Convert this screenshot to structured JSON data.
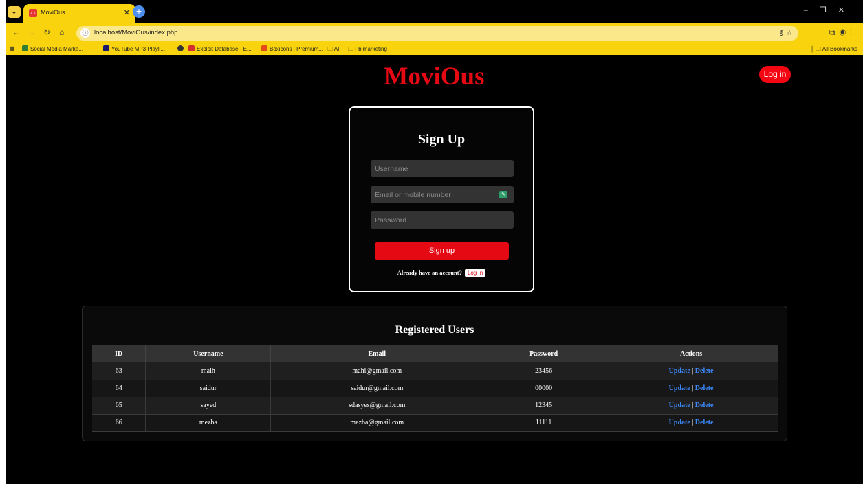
{
  "browser": {
    "tab_title": "MoviOus",
    "url": "localhost/MoviOus/index.php",
    "bookmarks": [
      {
        "label": "Social Media Marke...",
        "color": "#2e7d32"
      },
      {
        "label": "YouTube MP3 Playli...",
        "color": "#1a1a6e"
      },
      {
        "label": "",
        "color": "#333333"
      },
      {
        "label": "Exploit Database - E...",
        "color": "#d32f2f"
      },
      {
        "label": "Boxicons : Premium...",
        "color": "#e64a19"
      },
      {
        "label": "AI",
        "color": "none"
      },
      {
        "label": "Fb marketing",
        "color": "none"
      }
    ],
    "all_bookmarks": "All Bookmarks",
    "accent_color": "#f8d30e"
  },
  "header": {
    "brand": "MoviOus",
    "login_button": "Log in",
    "brand_color": "#e50914"
  },
  "signup": {
    "title": "Sign Up",
    "username_placeholder": "Username",
    "email_placeholder": "Email or mobile number",
    "password_placeholder": "Password",
    "submit_label": "Sign up",
    "already_text": "Already have an account?",
    "login_link": "Log In"
  },
  "users": {
    "title": "Registered Users",
    "columns": [
      "ID",
      "Username",
      "Email",
      "Password",
      "Actions"
    ],
    "rows": [
      {
        "id": "63",
        "username": "maih",
        "email": "mahi@gmail.com",
        "password": "23456",
        "update": "Update",
        "sep": "|",
        "delete": "Delete"
      },
      {
        "id": "64",
        "username": "saidur",
        "email": "saidur@gmail.com",
        "password": "00000",
        "update": "Update",
        "sep": "|",
        "delete": "Delete"
      },
      {
        "id": "65",
        "username": "sayed",
        "email": "sdasyes@gmail.com",
        "password": "12345",
        "update": "Update",
        "sep": "|",
        "delete": "Delete"
      },
      {
        "id": "66",
        "username": "mezba",
        "email": "mezba@gmail.com",
        "password": "11111",
        "update": "Update",
        "sep": "|",
        "delete": "Delete"
      }
    ]
  }
}
